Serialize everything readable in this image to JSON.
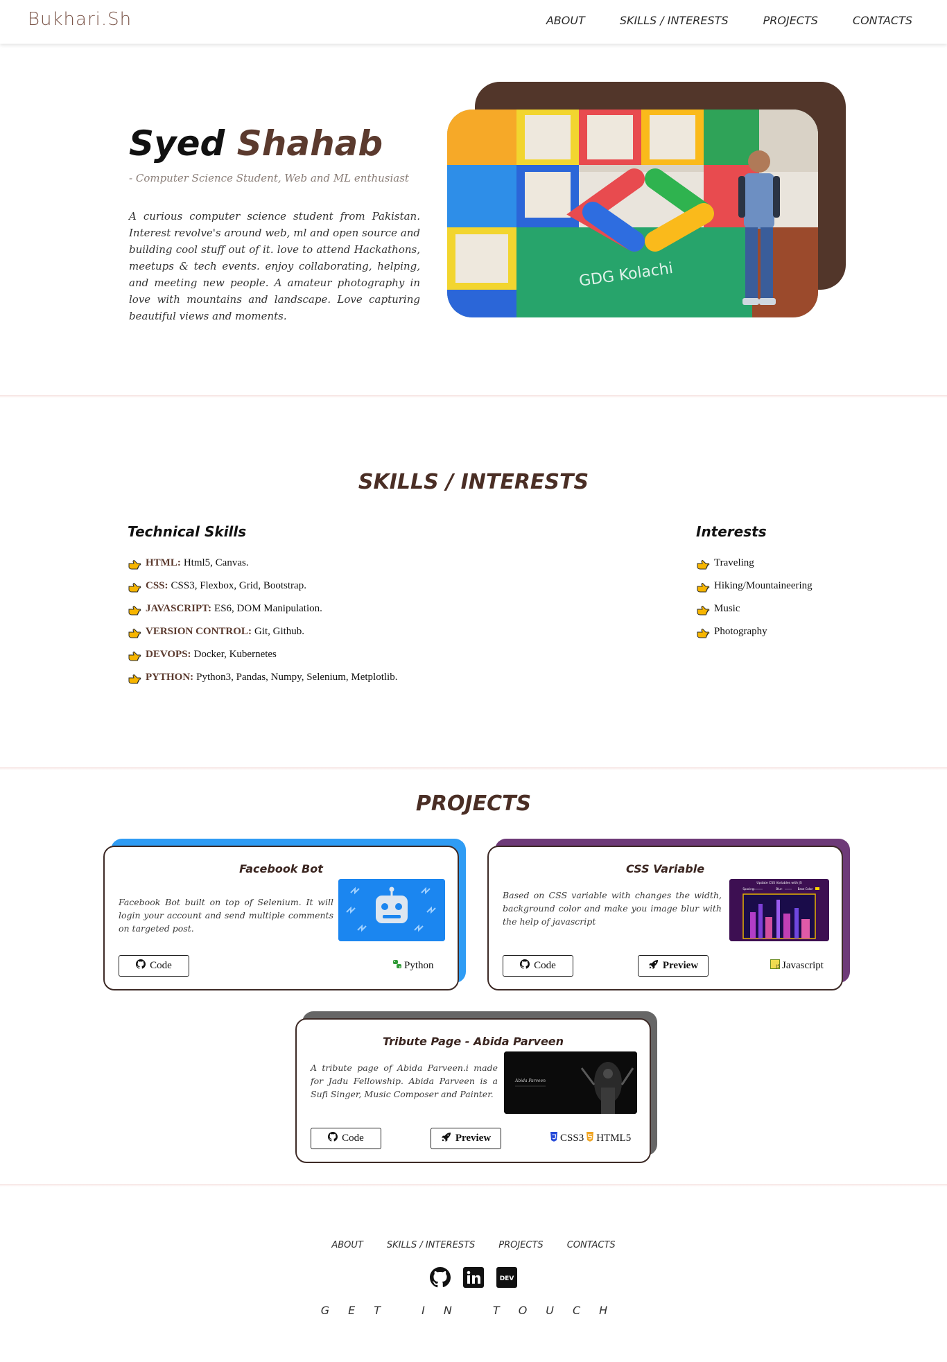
{
  "nav": {
    "brand": "Bukhari.Sh",
    "links": [
      "ABOUT",
      "SKILLS / INTERESTS",
      "PROJECTS",
      "CONTACTS"
    ]
  },
  "hero": {
    "first_name": "Syed",
    "last_name": "Shahab",
    "subtitle": "- Computer Science Student, Web and ML enthusiast",
    "description": "A curious computer science student from Pakistan. Interest revolve's around web, ml and open source and building cool stuff out of it. love to attend Hackathons, meetups & tech events. enjoy collaborating, helping, and meeting new people. A amateur photography in love with mountains and landscape. Love capturing beautiful views and moments.",
    "photo_caption": "GDG Kolachi"
  },
  "skills": {
    "title": "SKILLS / INTERESTS",
    "technical_title": "Technical Skills",
    "technical": [
      {
        "key": "HTML:",
        "value": "Html5, Canvas."
      },
      {
        "key": "CSS:",
        "value": "CSS3, Flexbox, Grid, Bootstrap."
      },
      {
        "key": "JAVASCRIPT:",
        "value": "ES6, DOM Manipulation."
      },
      {
        "key": "VERSION CONTROL:",
        "value": "Git, Github."
      },
      {
        "key": "DEVOPS:",
        "value": "Docker, Kubernetes"
      },
      {
        "key": "PYTHON:",
        "value": "Python3, Pandas, Numpy, Selenium, Metplotlib."
      }
    ],
    "interests_title": "Interests",
    "interests": [
      "Traveling",
      "Hiking/Mountaineering",
      "Music",
      "Photography"
    ]
  },
  "projects": {
    "title": "PROJECTS",
    "items": [
      {
        "title": "Facebook Bot",
        "description": "Facebook Bot built on top of Selenium. It will login your account and send multiple comments on targeted post.",
        "code_label": "Code",
        "tech": [
          "Python"
        ],
        "accent": "#2f9cf4"
      },
      {
        "title": "CSS Variable",
        "description": "Based on CSS variable with changes the width, background color and make you image blur with the help of javascript",
        "code_label": "Code",
        "preview_label": "Preview",
        "tech": [
          "Javascript"
        ],
        "accent": "#6e3a78",
        "thumb_title": "Update CSS Variables with JS",
        "thumb_labels": [
          "Spacing:",
          "Blur:",
          "Base Color:"
        ]
      },
      {
        "title": "Tribute Page - Abida Parveen",
        "description": "A tribute page of Abida Parveen.i made for Jadu Fellowship. Abida Parveen is a Sufi Singer, Music Composer and Painter.",
        "code_label": "Code",
        "preview_label": "Preview",
        "tech": [
          "CSS3",
          "HTML5"
        ],
        "accent": "#666666",
        "thumb_text": "Abida Parveen"
      }
    ]
  },
  "footer": {
    "links": [
      "ABOUT",
      "SKILLS / INTERESTS",
      "PROJECTS",
      "CONTACTS"
    ],
    "icons": [
      "github-icon",
      "linkedin-icon",
      "dev-icon"
    ],
    "dev_label": "DEV",
    "cta": "GET IN TOUCH"
  }
}
